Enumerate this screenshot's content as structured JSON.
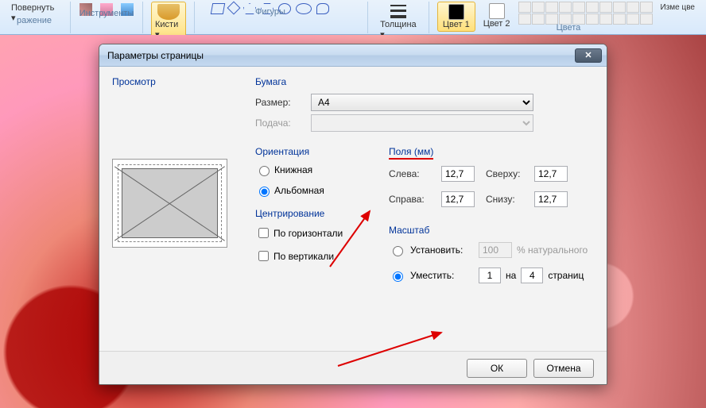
{
  "ribbon": {
    "rotate_label": "Повернуть ▾",
    "group_image": "ражение",
    "group_tools": "Инструменты",
    "brushes_label": "Кисти ▾",
    "group_shapes": "Фигуры",
    "thickness_label": "Толщина ▾",
    "color1_label": "Цвет 1",
    "color2_label": "Цвет 2",
    "group_colors": "Цвета",
    "edit_colors": "Изме цве"
  },
  "dialog": {
    "title": "Параметры страницы",
    "preview_label": "Просмотр",
    "paper_label": "Бумага",
    "size_label": "Размер:",
    "size_value": "A4",
    "source_label": "Подача:",
    "orientation_label": "Ориентация",
    "orientation_portrait": "Книжная",
    "orientation_landscape": "Альбомная",
    "centering_label": "Центрирование",
    "center_h": "По горизонтали",
    "center_v": "По вертикали",
    "margins_label": "Поля (мм)",
    "margin_left_lbl": "Слева:",
    "margin_right_lbl": "Справа:",
    "margin_top_lbl": "Сверху:",
    "margin_bottom_lbl": "Снизу:",
    "margin_left": "12,7",
    "margin_right": "12,7",
    "margin_top": "12,7",
    "margin_bottom": "12,7",
    "scale_label": "Масштаб",
    "scale_set": "Установить:",
    "scale_set_val": "100",
    "scale_set_suffix": "% натурального",
    "scale_fit": "Уместить:",
    "scale_fit_w": "1",
    "scale_fit_mid": "на",
    "scale_fit_h": "4",
    "scale_fit_suffix": "страниц",
    "ok": "ОК",
    "cancel": "Отмена"
  }
}
